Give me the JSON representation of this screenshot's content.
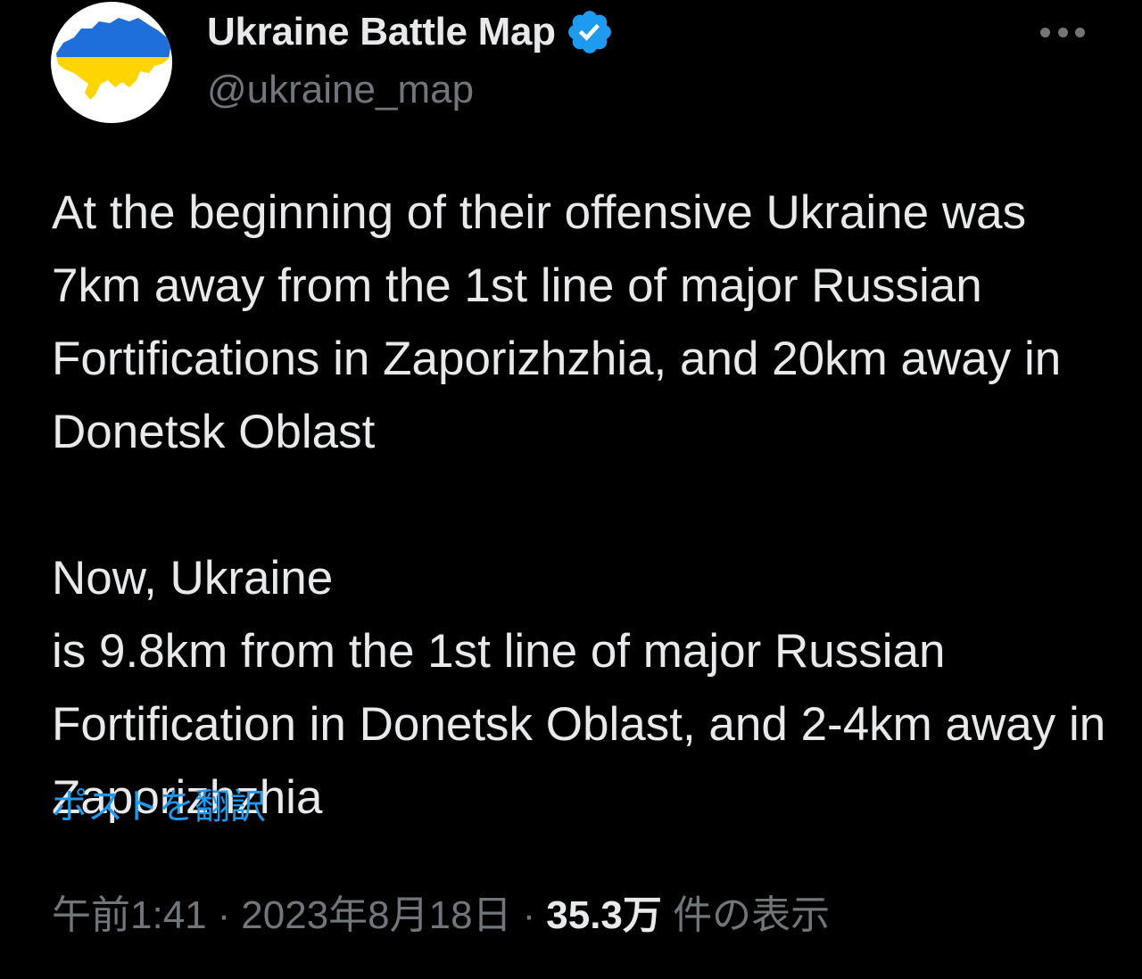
{
  "account": {
    "display_name": "Ukraine Battle Map",
    "handle": "@ukraine_map",
    "verified": true,
    "avatar_icon": "ukraine-map-flag-icon"
  },
  "tweet": {
    "paragraph_1": "At the beginning of their offensive Ukraine was 7km away from the 1st line of major Russian Fortifications in Zaporizhzhia, and 20km away in Donetsk Oblast",
    "paragraph_2_before": "Now, Ukraine",
    "paragraph_2_emoji": "ukraine-flag-emoji",
    "paragraph_2_after": "is 9.8km from the 1st line of major Russian Fortification in Donetsk Oblast, and 2-4km away in Zaporizhzhia"
  },
  "translate_label": "ポストを翻訳",
  "meta": {
    "time": "午前1:41",
    "separator": "·",
    "date": "2023年8月18日",
    "views_count": "35.3万",
    "views_label": "件の表示"
  },
  "colors": {
    "background": "#000000",
    "text": "#e7e9ea",
    "secondary": "#71767b",
    "link": "#1d9bf0",
    "flag_blue": "#1e6fd9",
    "flag_yellow": "#ffd500"
  }
}
